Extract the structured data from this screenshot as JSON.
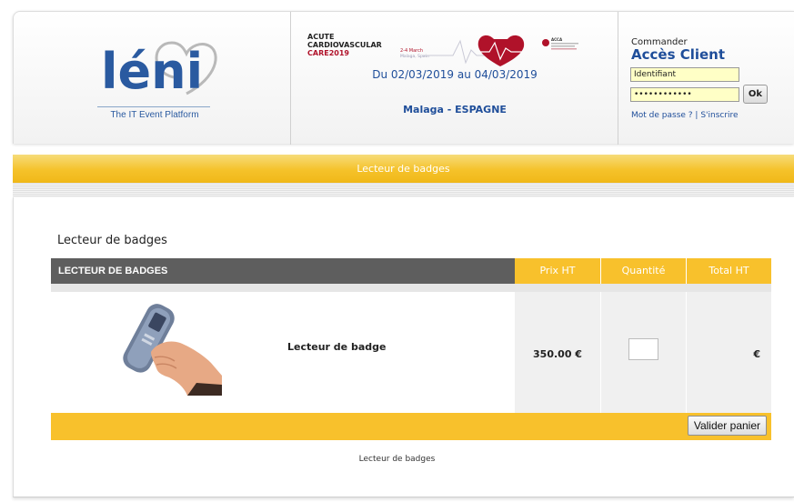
{
  "brand": {
    "logo_text": "léni",
    "tagline": "The IT Event Platform",
    "accent_color": "#2a5aa0"
  },
  "event": {
    "banner_lines": [
      "ACUTE",
      "CARDIOVASCULAR",
      "CARE2019"
    ],
    "banner_sub": "2-4 March",
    "banner_location": "Malaga, Spain",
    "banner_org": "ACCA",
    "dates": "Du 02/03/2019 au 04/03/2019",
    "place": "Malaga - ESPAGNE"
  },
  "client": {
    "order_label": "Commander",
    "title": "Accès Client",
    "login_value": "Identifiant",
    "password_value": "••••••••••••",
    "ok_label": "Ok",
    "forgot_link": "Mot de passe ?",
    "separator": " | ",
    "signup_link": "S'inscrire"
  },
  "title_bar": "Lecteur de badges",
  "section_title": "Lecteur de badges",
  "table": {
    "headers": {
      "item": "LECTEUR DE BADGES",
      "price": "Prix HT",
      "qty": "Quantité",
      "total": "Total HT"
    },
    "rows": [
      {
        "name": "Lecteur de badge",
        "price": "350.00 €",
        "qty": "",
        "total": "€",
        "image_icon": "badge-reader-hand"
      }
    ]
  },
  "validate_label": "Valider panier",
  "footer_text": "Lecteur de badges",
  "colors": {
    "yellow": "#f8c12c",
    "dark_header": "#5e5e5e",
    "blue_text": "#1f4e9a"
  }
}
